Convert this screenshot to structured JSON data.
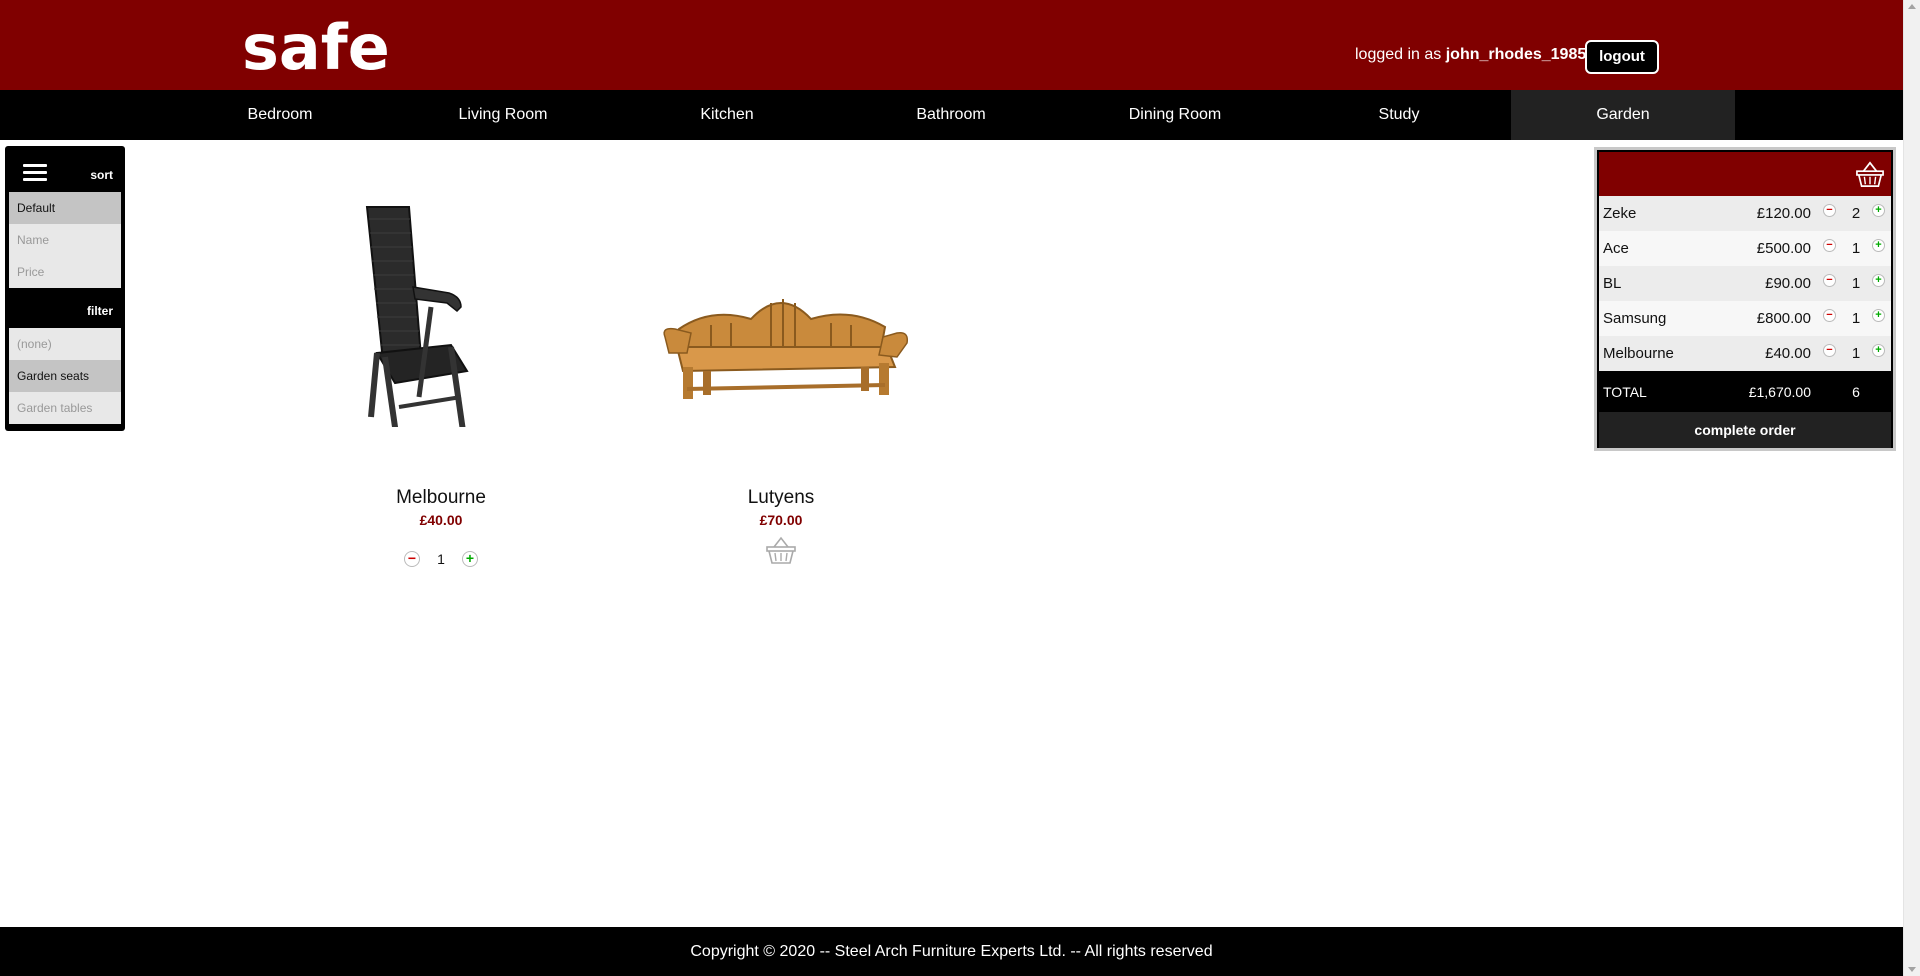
{
  "header": {
    "logo": "safe",
    "logged_in_prefix": "logged in as ",
    "username": "john_rhodes_1985",
    "logout_label": "logout",
    "brand_color": "#800000"
  },
  "nav": {
    "items": [
      {
        "label": "Bedroom"
      },
      {
        "label": "Living Room"
      },
      {
        "label": "Kitchen"
      },
      {
        "label": "Bathroom"
      },
      {
        "label": "Dining Room"
      },
      {
        "label": "Study"
      },
      {
        "label": "Garden",
        "active": true
      }
    ]
  },
  "sidebar": {
    "menu_icon": "hamburger-icon",
    "sort_label": "sort",
    "sort_options": [
      "Default",
      "Name",
      "Price"
    ],
    "sort_selected": "Default",
    "filter_label": "filter",
    "filter_options": [
      "(none)",
      "Garden seats",
      "Garden tables"
    ],
    "filter_selected": "Garden seats"
  },
  "products": [
    {
      "name": "Melbourne",
      "price": "£40.00",
      "quantity": "1",
      "in_cart": true
    },
    {
      "name": "Lutyens",
      "price": "£70.00",
      "in_cart": false,
      "icon": "basket-icon"
    }
  ],
  "cart": {
    "icon": "basket-icon",
    "items": [
      {
        "name": "Zeke",
        "price": "£120.00",
        "qty": "2"
      },
      {
        "name": "Ace",
        "price": "£500.00",
        "qty": "1"
      },
      {
        "name": "BL",
        "price": "£90.00",
        "qty": "1"
      },
      {
        "name": "Samsung",
        "price": "£800.00",
        "qty": "1"
      },
      {
        "name": "Melbourne",
        "price": "£40.00",
        "qty": "1"
      }
    ],
    "total_label": "TOTAL",
    "total_price": "£1,670.00",
    "total_qty": "6",
    "complete_label": "complete order"
  },
  "footer": {
    "copyright": "Copyright © 2020 -- Steel Arch Furniture Experts Ltd. -- All rights reserved"
  }
}
